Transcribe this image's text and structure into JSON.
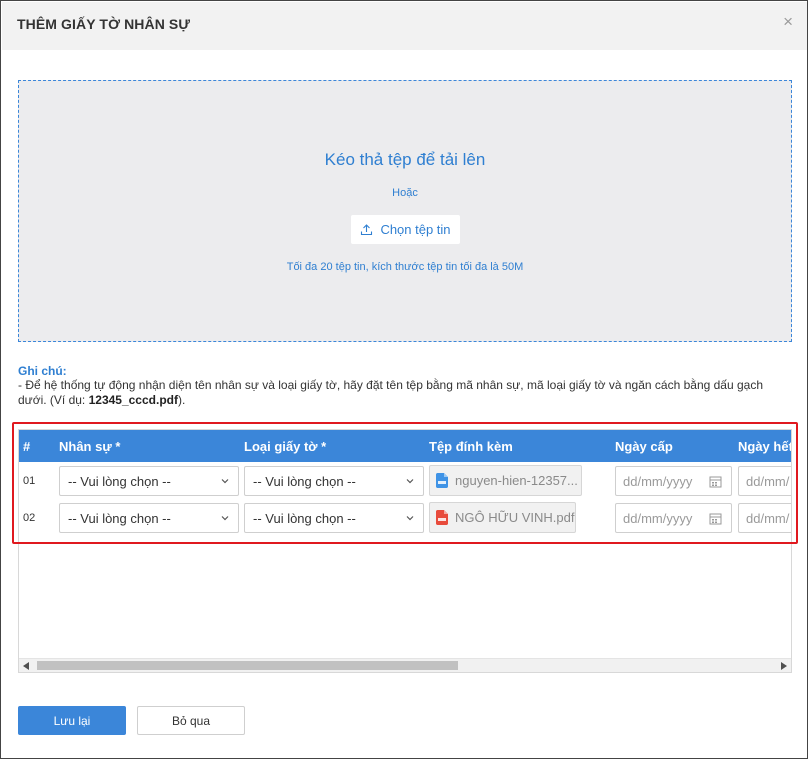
{
  "modal": {
    "title": "THÊM GIẤY TỜ NHÂN SỰ",
    "close_glyph": "×"
  },
  "dropzone": {
    "title": "Kéo thả tệp để tải lên",
    "or_text": "Hoặc",
    "choose_button": "Chọn tệp tin",
    "limit_text": "Tối đa 20 tệp tin, kích thước tệp tin tối đa là 50M"
  },
  "note": {
    "title": "Ghi chú:",
    "text": "- Để hệ thống tự động nhận diện tên nhân sự và loại giấy tờ, hãy đặt tên tệp bằng mã nhân sự, mã loại giấy tờ và ngăn cách bằng dấu gạch dưới. (Ví dụ: ",
    "example": "12345_cccd.pdf",
    "text_end": ")."
  },
  "table": {
    "headers": {
      "num": "#",
      "employee": "Nhân sự *",
      "doc_type": "Loại giấy tờ *",
      "attachment": "Tệp đính kèm",
      "issue_date": "Ngày cấp",
      "expiry_date": "Ngày hết"
    },
    "rows": [
      {
        "num": "01",
        "employee": "-- Vui lòng chọn --",
        "doc_type": "-- Vui lòng chọn --",
        "file_name": "nguyen-hien-12357...",
        "file_icon": "doc-file-icon",
        "issue_date_placeholder": "dd/mm/yyyy",
        "expiry_date_placeholder": "dd/mm/"
      },
      {
        "num": "02",
        "employee": "-- Vui lòng chọn --",
        "doc_type": "-- Vui lòng chọn --",
        "file_name": "NGÔ HỮU VINH.pdf",
        "file_icon": "pdf-file-icon",
        "issue_date_placeholder": "dd/mm/yyyy",
        "expiry_date_placeholder": "dd/mm/"
      }
    ]
  },
  "footer": {
    "save_label": "Lưu lại",
    "cancel_label": "Bỏ qua"
  },
  "colors": {
    "accent": "#3b86d9",
    "highlight": "#e0191f",
    "dropzone_bg": "#ececee"
  }
}
